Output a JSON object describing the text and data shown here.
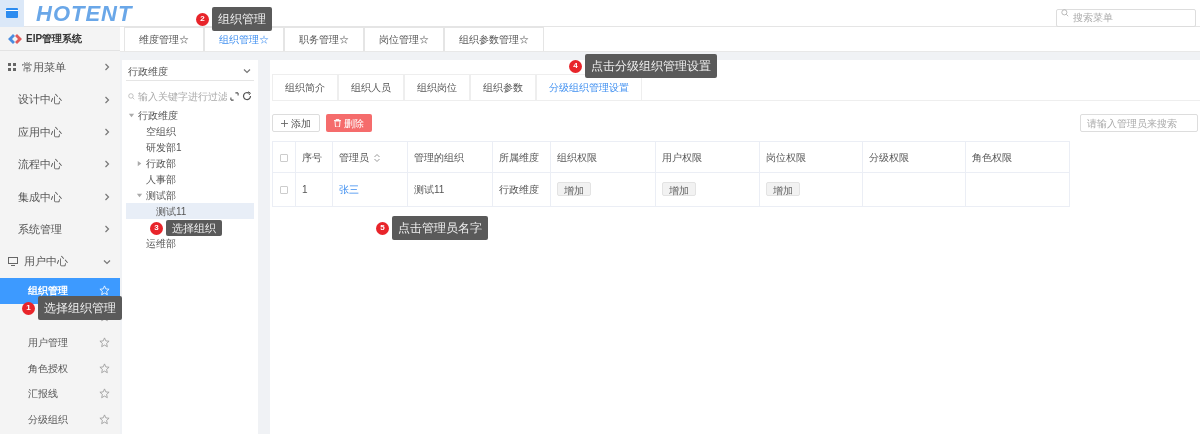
{
  "header": {
    "logo": "HOTENT",
    "search": {
      "placeholder": "搜索菜单"
    }
  },
  "sidebar": {
    "title": "EIP管理系统",
    "items": [
      {
        "label": "常用菜单",
        "expanded": false
      },
      {
        "label": "设计中心",
        "expanded": false
      },
      {
        "label": "应用中心",
        "expanded": false
      },
      {
        "label": "流程中心",
        "expanded": false
      },
      {
        "label": "集成中心",
        "expanded": false
      },
      {
        "label": "系统管理",
        "expanded": false
      },
      {
        "label": "用户中心",
        "expanded": true,
        "children": [
          {
            "label": "组织管理",
            "selected": true
          },
          {
            "selected": false
          },
          {
            "label": "用户管理",
            "selected": false
          },
          {
            "label": "角色授权",
            "selected": false
          },
          {
            "label": "汇报线",
            "selected": false
          },
          {
            "label": "分级组织",
            "selected": false
          }
        ]
      }
    ]
  },
  "tabs": [
    {
      "label": "维度管理☆",
      "selected": false
    },
    {
      "label": "组织管理☆",
      "selected": true
    },
    {
      "label": "职务管理☆",
      "selected": false
    },
    {
      "label": "岗位管理☆",
      "selected": false
    },
    {
      "label": "组织参数管理☆",
      "selected": false
    }
  ],
  "tree": {
    "dimension": "行政维度",
    "search": {
      "placeholder": "输入关键字进行过滤"
    },
    "nodes": [
      {
        "label": "行政维度",
        "expanded": true,
        "selected": false,
        "children": [
          {
            "label": "空组织",
            "selected": false
          },
          {
            "label": "研发部1",
            "selected": false
          },
          {
            "label": "行政部",
            "expanded": false,
            "selected": false
          },
          {
            "label": "人事部",
            "selected": false
          },
          {
            "label": "测试部",
            "expanded": true,
            "selected": false,
            "children": [
              {
                "label": "测试11",
                "selected": true
              },
              {
                "selected": false
              }
            ]
          },
          {
            "label": "运维部",
            "selected": false
          }
        ]
      }
    ]
  },
  "subtabs": [
    {
      "label": "组织简介",
      "selected": false
    },
    {
      "label": "组织人员",
      "selected": false
    },
    {
      "label": "组织岗位",
      "selected": false
    },
    {
      "label": "组织参数",
      "selected": false
    },
    {
      "label": "分级组织管理设置",
      "selected": true
    }
  ],
  "toolbar": {
    "add": "添加",
    "delete": "删除",
    "search": {
      "placeholder": "请输入管理员来搜索"
    }
  },
  "table": {
    "header_checked": false,
    "columns": [
      "序号",
      "管理员",
      "管理的组织",
      "所属维度",
      "组织权限",
      "用户权限",
      "岗位权限",
      "分级权限",
      "角色权限"
    ],
    "rows": [
      {
        "checked": false,
        "cells": [
          "1",
          "张三",
          "测试11",
          "行政维度",
          "增加",
          "增加",
          "增加",
          "",
          ""
        ]
      }
    ]
  },
  "callouts": [
    {
      "number": "1",
      "text": "选择组织管理"
    },
    {
      "number": "2",
      "text": "组织管理"
    },
    {
      "number": "3",
      "text": "选择组织"
    },
    {
      "number": "4",
      "text": "点击分级组织管理设置"
    },
    {
      "number": "5",
      "text": "点击管理员名字"
    }
  ]
}
